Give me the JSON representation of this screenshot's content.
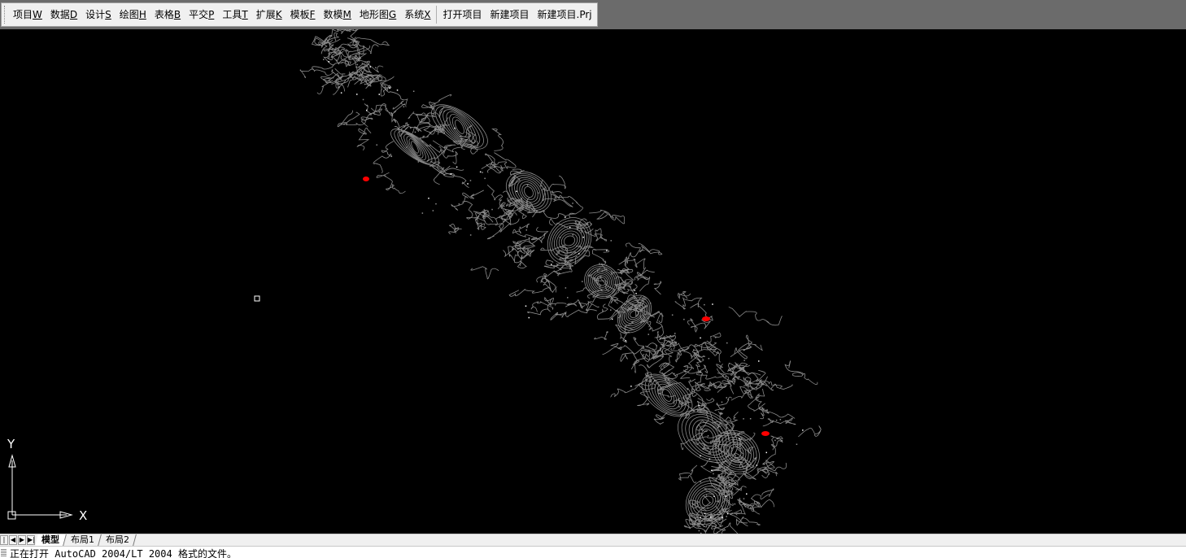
{
  "menu": {
    "items": [
      {
        "label": "项目",
        "key": "W"
      },
      {
        "label": "数据",
        "key": "D"
      },
      {
        "label": "设计",
        "key": "S"
      },
      {
        "label": "绘图",
        "key": "H"
      },
      {
        "label": "表格",
        "key": "B"
      },
      {
        "label": "平交",
        "key": "P"
      },
      {
        "label": "工具",
        "key": "T"
      },
      {
        "label": "扩展",
        "key": "K"
      },
      {
        "label": "模板",
        "key": "F"
      },
      {
        "label": "数模",
        "key": "M"
      },
      {
        "label": "地形图",
        "key": "G"
      },
      {
        "label": "系统",
        "key": "X"
      }
    ],
    "actions": [
      "打开项目",
      "新建项目",
      "新建项目.Prj"
    ]
  },
  "ucs": {
    "x_label": "X",
    "y_label": "Y"
  },
  "tabs": {
    "nav_buttons": [
      "|◀",
      "◀",
      "▶",
      "▶|"
    ],
    "items": [
      "模型",
      "布局1",
      "布局2"
    ],
    "active": "模型"
  },
  "command_line": {
    "text": "正在打开 AutoCAD 2004/LT 2004 格式的文件。"
  },
  "colors": {
    "background": "#000000",
    "contour": "#8c8c8c",
    "marker": "#ff0000",
    "ucs": "#ffffff"
  }
}
